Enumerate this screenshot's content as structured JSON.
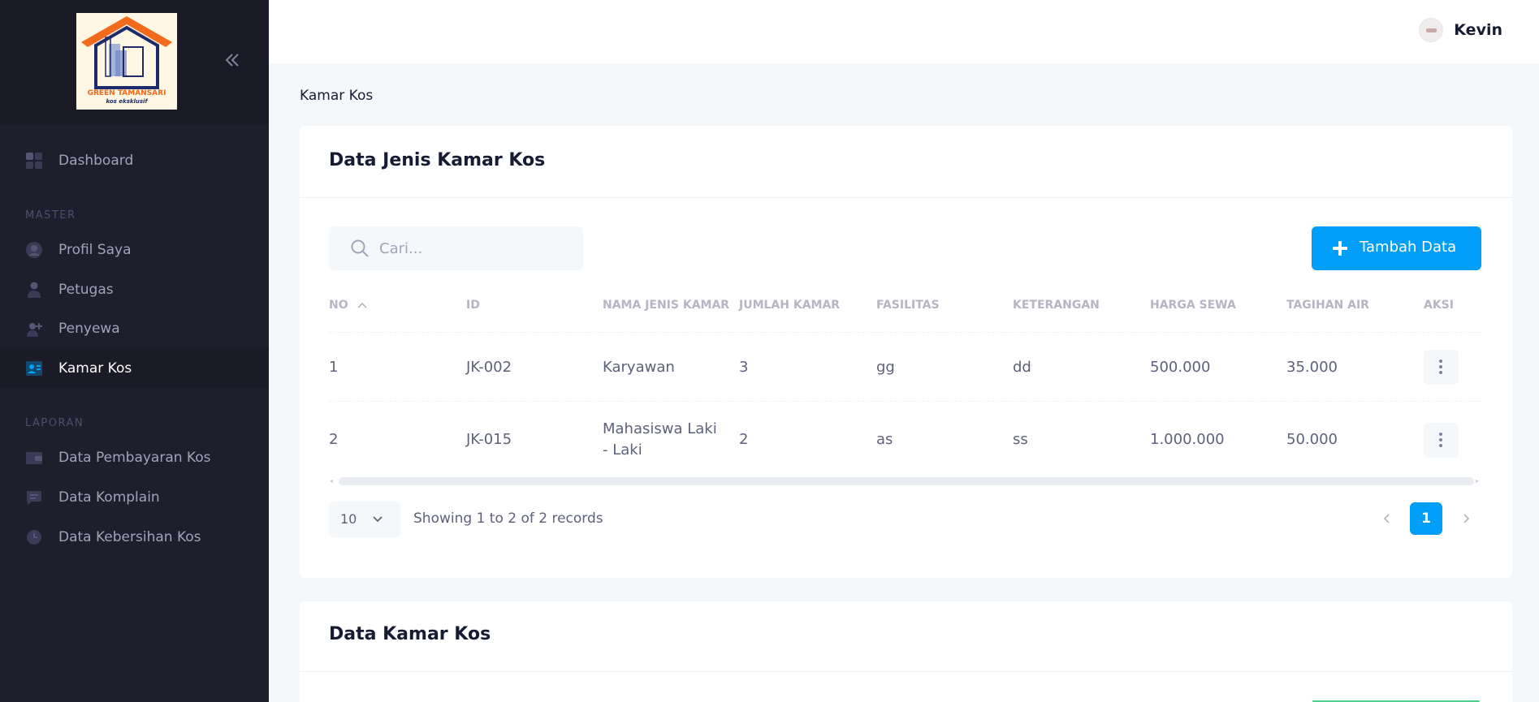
{
  "sidebar": {
    "logo": {
      "line1": "GREEN TAMANSARI",
      "line2": "kos eksklusif"
    },
    "items": [
      {
        "label": "Dashboard",
        "icon": "dashboard-icon"
      },
      {
        "label": "Profil Saya",
        "icon": "user-circle-icon"
      },
      {
        "label": "Petugas",
        "icon": "person-icon"
      },
      {
        "label": "Penyewa",
        "icon": "person-add-icon"
      },
      {
        "label": "Kamar Kos",
        "icon": "id-card-icon",
        "active": true
      },
      {
        "label": "Data Pembayaran Kos",
        "icon": "wallet-icon"
      },
      {
        "label": "Data Komplain",
        "icon": "message-icon"
      },
      {
        "label": "Data Kebersihan Kos",
        "icon": "clock-icon"
      }
    ],
    "sections": {
      "master": "MASTER",
      "laporan": "LAPORAN"
    }
  },
  "header": {
    "user_name": "Kevin"
  },
  "breadcrumb": "Kamar Kos",
  "card1": {
    "title": "Data Jenis Kamar Kos",
    "search_placeholder": "Cari...",
    "add_label": "Tambah Data",
    "columns": [
      "NO",
      "ID",
      "NAMA JENIS KAMAR",
      "JUMLAH KAMAR",
      "FASILITAS",
      "KETERANGAN",
      "HARGA SEWA",
      "TAGIHAN AIR",
      "AKSI"
    ],
    "rows": [
      {
        "no": "1",
        "id": "JK-002",
        "nama_l1": "Karyawan",
        "nama_l2": "",
        "jumlah": "3",
        "fasilitas": "gg",
        "keterangan": "dd",
        "harga": "500.000",
        "air": "35.000"
      },
      {
        "no": "2",
        "id": "JK-015",
        "nama_l1": "Mahasiswa Laki",
        "nama_l2": "- Laki",
        "jumlah": "2",
        "fasilitas": "as",
        "keterangan": "ss",
        "harga": "1.000.000",
        "air": "50.000"
      }
    ],
    "page_size": "10",
    "showing": "Showing 1 to 2 of 2 records",
    "current_page": "1"
  },
  "card2": {
    "title": "Data Kamar Kos"
  },
  "colors": {
    "primary": "#009ef7",
    "sidebar_bg": "#1e1e2d",
    "success": "#50cd89"
  }
}
